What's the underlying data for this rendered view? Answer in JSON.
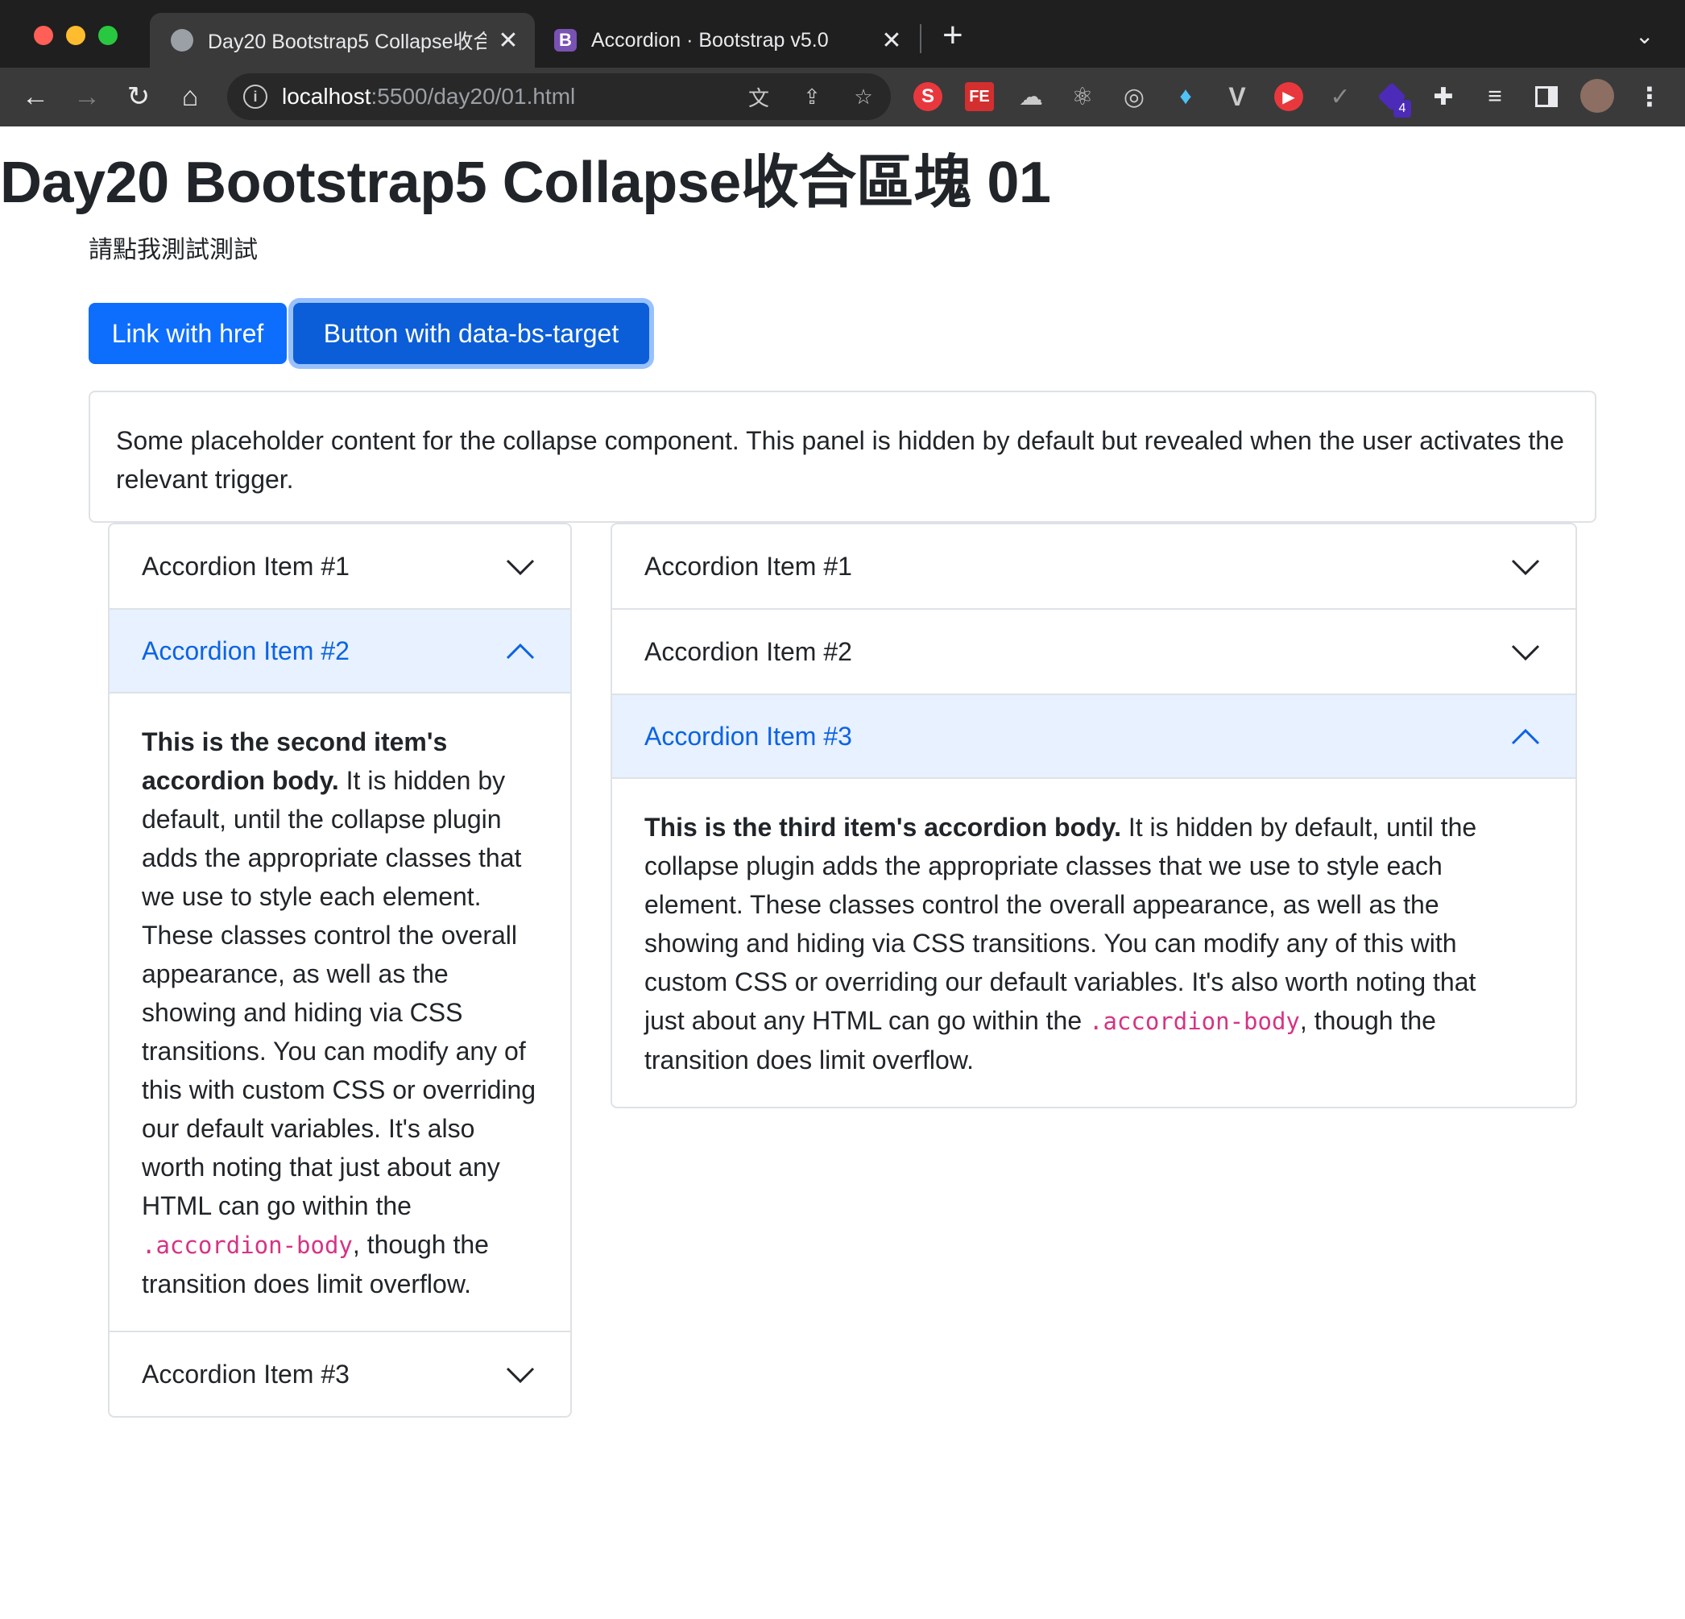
{
  "browser": {
    "tabs": [
      {
        "title": "Day20 Bootstrap5 Collapse收合",
        "active": true
      },
      {
        "title": "Accordion · Bootstrap v5.0",
        "active": false
      }
    ],
    "url_host": "localhost",
    "url_path": ":5500/day20/01.html",
    "extensions": [
      "S",
      "FE",
      "4"
    ]
  },
  "page": {
    "title": "Day20 Bootstrap5 Collapse收合區塊 01",
    "intro": "請點我測試測試",
    "buttons": {
      "link": "Link with href",
      "button": "Button with data-bs-target"
    },
    "collapse_text": "Some placeholder content for the collapse component. This panel is hidden by default but revealed when the user activates the relevant trigger."
  },
  "accordion_left": {
    "items": [
      {
        "label": "Accordion Item #1",
        "open": false
      },
      {
        "label": "Accordion Item #2",
        "open": true,
        "body_bold": "This is the second item's accordion body.",
        "body_text": " It is hidden by default, until the collapse plugin adds the appropriate classes that we use to style each element. These classes control the overall appearance, as well as the showing and hiding via CSS transitions. You can modify any of this with custom CSS or overriding our default variables. It's also worth noting that just about any HTML can go within the ",
        "body_code": ".accordion-body",
        "body_tail": ", though the transition does limit overflow."
      },
      {
        "label": "Accordion Item #3",
        "open": false
      }
    ]
  },
  "accordion_right": {
    "items": [
      {
        "label": "Accordion Item #1",
        "open": false
      },
      {
        "label": "Accordion Item #2",
        "open": false
      },
      {
        "label": "Accordion Item #3",
        "open": true,
        "body_bold": "This is the third item's accordion body.",
        "body_text": " It is hidden by default, until the collapse plugin adds the appropriate classes that we use to style each element. These classes control the overall appearance, as well as the showing and hiding via CSS transitions. You can modify any of this with custom CSS or overriding our default variables. It's also worth noting that just about any HTML can go within the ",
        "body_code": ".accordion-body",
        "body_tail": ", though the transition does limit overflow."
      }
    ]
  },
  "colors": {
    "primary": "#0d6efd",
    "accordion_open_bg": "#e7f1ff",
    "accordion_open_text": "#0c63e4",
    "code": "#d63384"
  }
}
